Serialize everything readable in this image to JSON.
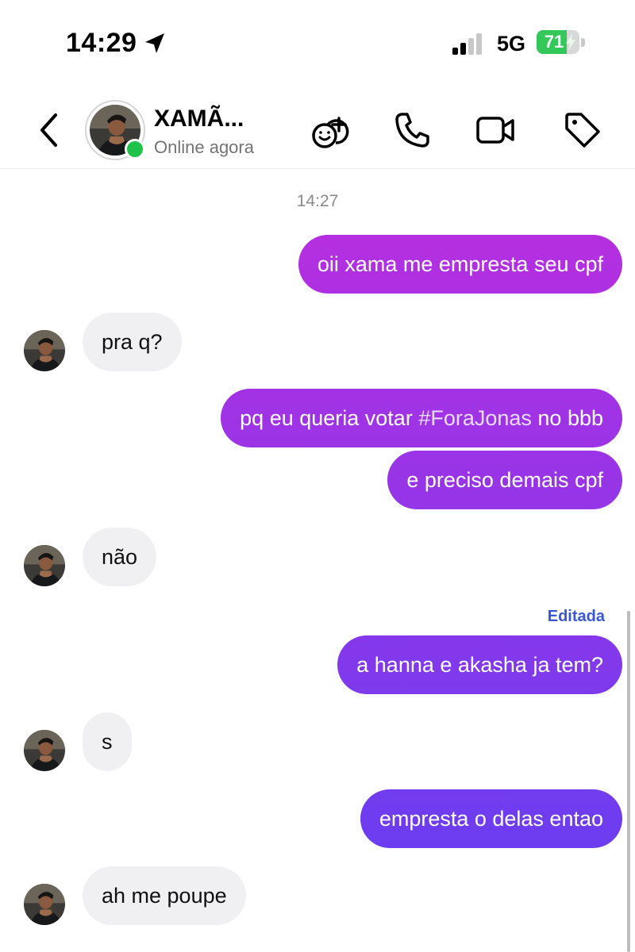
{
  "status_bar": {
    "time": "14:29",
    "network": "5G",
    "battery_percent": "71",
    "battery_level": 0.71
  },
  "header": {
    "contact_name": "XAMÃ...",
    "presence": "Online agora"
  },
  "icons": [
    "location-arrow-icon",
    "signal-icon",
    "battery-icon",
    "chevron-left-icon",
    "avatar",
    "sticker-add-icon",
    "phone-icon",
    "video-camera-icon",
    "tag-icon"
  ],
  "colors": {
    "out_gradient_top": "#b52fe0",
    "out_gradient_bottom": "#6c3df0",
    "in_bubble": "#f0f0f3",
    "online": "#1fc24a",
    "edited": "#3a57d6"
  },
  "chat": {
    "timestamp": "14:27",
    "messages": [
      {
        "dir": "out",
        "text": "oii xama me empresta seu cpf"
      },
      {
        "dir": "in",
        "text": "pra q?"
      },
      {
        "dir": "out",
        "text_before": "pq eu queria votar ",
        "hashtag": "#ForaJonas",
        "text_after": " no bbb"
      },
      {
        "dir": "out",
        "text": "e preciso demais cpf"
      },
      {
        "dir": "in",
        "text": "não"
      },
      {
        "dir": "out",
        "edited_label": "Editada",
        "text": "a hanna e akasha ja tem?"
      },
      {
        "dir": "in",
        "text": "s"
      },
      {
        "dir": "out",
        "text": "empresta o delas entao"
      },
      {
        "dir": "in",
        "text": "ah me poupe"
      }
    ]
  }
}
